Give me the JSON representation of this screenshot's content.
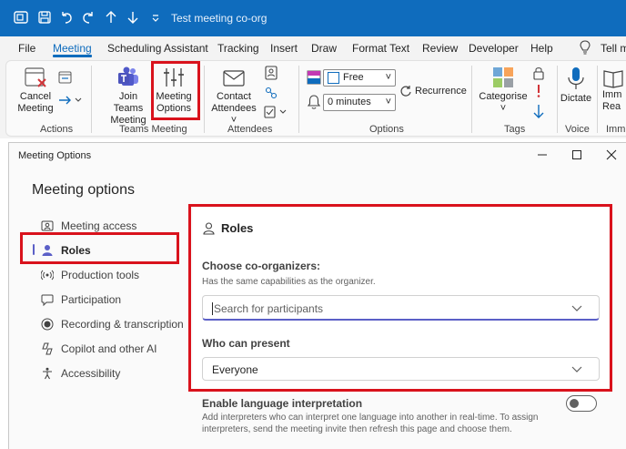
{
  "window": {
    "title": "Test meeting co-org"
  },
  "menu": {
    "tabs": [
      "File",
      "Meeting",
      "Scheduling Assistant",
      "Tracking",
      "Insert",
      "Draw",
      "Format Text",
      "Review",
      "Developer",
      "Help",
      "Tell m"
    ]
  },
  "ribbon": {
    "cancel_meeting": [
      "Cancel",
      "Meeting"
    ],
    "join_teams": [
      "Join Teams",
      "Meeting"
    ],
    "meeting_options": [
      "Meeting",
      "Options"
    ],
    "contact_attendees": [
      "Contact",
      "Attendees"
    ],
    "show_as_value": "Free",
    "reminder_value": "0 minutes",
    "recurrence": "Recurrence",
    "categorise": "Categorise",
    "dictate": "Dictate",
    "immersive": [
      "Imm",
      "Rea"
    ],
    "groups": {
      "actions": "Actions",
      "teams_meeting": "Teams Meeting",
      "attendees": "Attendees",
      "options": "Options",
      "tags": "Tags",
      "voice": "Voice",
      "immersive": "Imm"
    }
  },
  "dialog": {
    "title": "Meeting Options",
    "heading": "Meeting options",
    "nav": [
      {
        "label": "Meeting access",
        "icon": "meeting-access-icon"
      },
      {
        "label": "Roles",
        "icon": "person-icon"
      },
      {
        "label": "Production tools",
        "icon": "broadcast-icon"
      },
      {
        "label": "Participation",
        "icon": "chat-icon"
      },
      {
        "label": "Recording & transcription",
        "icon": "record-icon"
      },
      {
        "label": "Copilot and other AI",
        "icon": "copilot-icon"
      },
      {
        "label": "Accessibility",
        "icon": "accessibility-icon"
      }
    ],
    "roles": {
      "title": "Roles",
      "coorg_label": "Choose co-organizers:",
      "coorg_sub": "Has the same capabilities as the organizer.",
      "search_placeholder": "Search for participants",
      "present_label": "Who can present",
      "present_value": "Everyone"
    },
    "interpretation": {
      "label": "Enable language interpretation",
      "desc_line1": "Add interpreters who can interpret one language into another in real-time. To assign",
      "desc_line2": "interpreters, send the meeting invite then refresh this page and choose them.",
      "enabled": false
    }
  },
  "colors": {
    "titlebar": "#0f6cbd",
    "highlight": "#d9121c",
    "accent": "#5b5fc7"
  }
}
